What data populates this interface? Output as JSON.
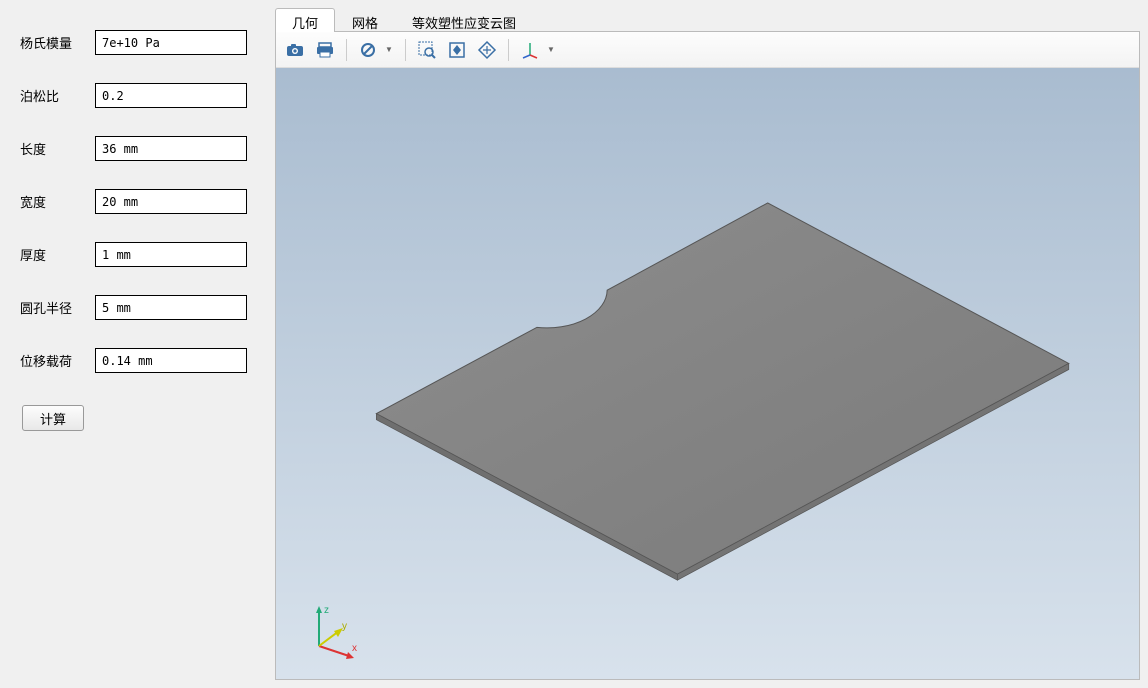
{
  "form": {
    "fields": [
      {
        "label": "杨氏模量",
        "value": "7e+10 Pa"
      },
      {
        "label": "泊松比",
        "value": "0.2"
      },
      {
        "label": "长度",
        "value": "36 mm"
      },
      {
        "label": "宽度",
        "value": "20 mm"
      },
      {
        "label": "厚度",
        "value": "1 mm"
      },
      {
        "label": "圆孔半径",
        "value": "5 mm"
      },
      {
        "label": "位移载荷",
        "value": "0.14 mm"
      }
    ],
    "compute_label": "计算"
  },
  "tabs": {
    "items": [
      {
        "label": "几何"
      },
      {
        "label": "网格"
      },
      {
        "label": "等效塑性应变云图"
      }
    ],
    "active_index": 0
  },
  "toolbar": {
    "icons": [
      "camera-icon",
      "print-icon",
      "sep",
      "nodrop-icon",
      "dropdown",
      "sep",
      "zoom-window-icon",
      "fit-view-icon",
      "rotate-icon",
      "sep",
      "axis-orient-icon",
      "dropdown"
    ]
  },
  "axis": {
    "x": "x",
    "y": "y",
    "z": "z"
  }
}
